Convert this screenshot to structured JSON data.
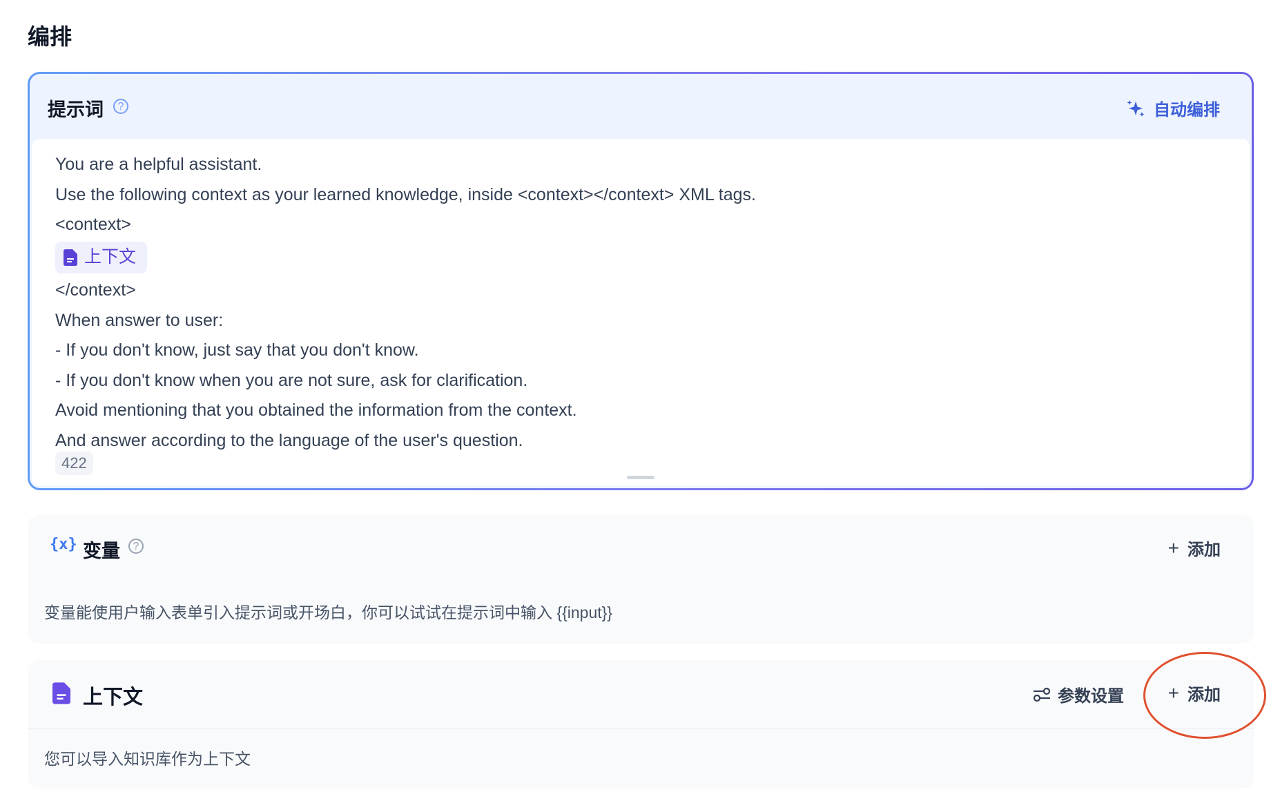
{
  "page": {
    "title": "编排"
  },
  "prompt": {
    "title": "提示词",
    "help_icon": "question-circle-icon",
    "auto_button_label": "自动编排",
    "auto_button_icon": "sparkle-icon",
    "lines_before": [
      "You are a helpful assistant.",
      "Use the following context as your learned knowledge, inside <context></context> XML tags.",
      "<context>"
    ],
    "context_chip_label": "上下文",
    "lines_after": [
      "</context>",
      "When answer to user:",
      "- If you don't know, just say that you don't know.",
      "- If you don't know when you are not sure, ask for clarification.",
      "Avoid mentioning that you obtained the information from the context.",
      "And answer according to the language of the user's question."
    ],
    "char_count": "422"
  },
  "variables": {
    "icon_text": "{x}",
    "title": "变量",
    "add_label": "添加",
    "description": "变量能使用户输入表单引入提示词或开场白，你可以试试在提示词中输入 {{input}}"
  },
  "context": {
    "title": "上下文",
    "params_label": "参数设置",
    "add_label": "添加",
    "description": "您可以导入知识库作为上下文"
  },
  "colors": {
    "accent": "#3d5fd9",
    "chip_purple": "#5741d6",
    "annotation_red": "#e0502f"
  }
}
